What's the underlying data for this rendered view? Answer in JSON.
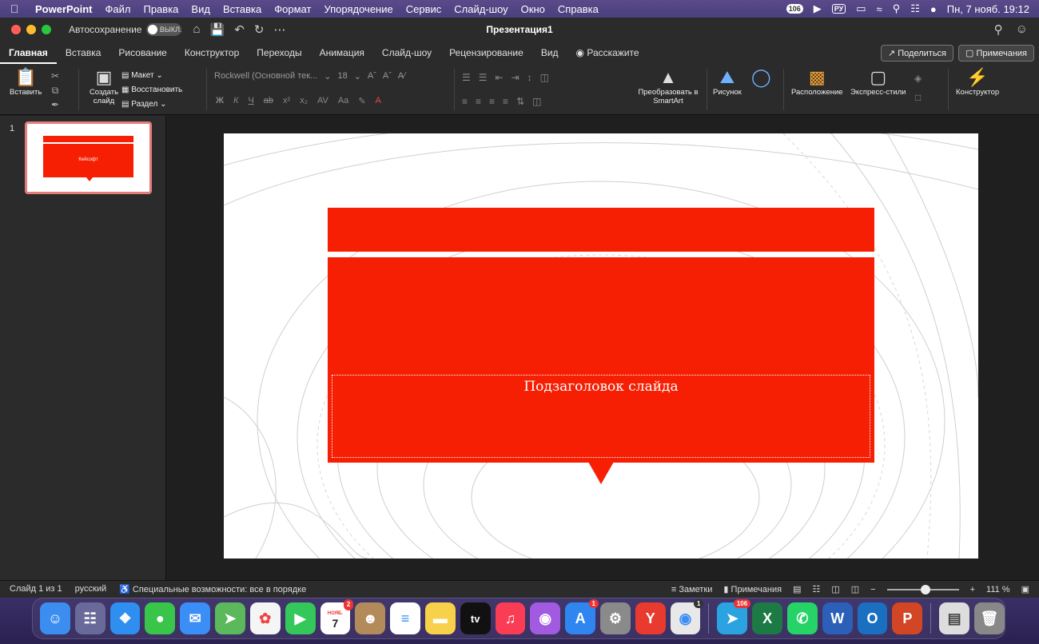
{
  "menubar": {
    "app": "PowerPoint",
    "items": [
      "Файл",
      "Правка",
      "Вид",
      "Вставка",
      "Формат",
      "Упорядочение",
      "Сервис",
      "Слайд-шоу",
      "Окно",
      "Справка"
    ],
    "badge": "106",
    "lang": "РУ",
    "datetime": "Пн, 7 нояб. 19:12"
  },
  "titlebar": {
    "autosave_label": "Автосохранение",
    "autosave_state": "ВЫКЛ.",
    "doc_title": "Презентация1"
  },
  "tabs": {
    "items": [
      "Главная",
      "Вставка",
      "Рисование",
      "Конструктор",
      "Переходы",
      "Анимация",
      "Слайд-шоу",
      "Рецензирование",
      "Вид"
    ],
    "tell_me": "Расскажите",
    "share": "Поделиться",
    "comments": "Примечания"
  },
  "ribbon": {
    "paste": "Вставить",
    "new_slide": "Создать слайд",
    "layout": "Макет",
    "reset": "Восстановить",
    "section": "Раздел",
    "font_name": "Rockwell (Основной тек...",
    "font_size": "18",
    "smartart": "Преобразовать в SmartArt",
    "picture": "Рисунок",
    "arrange": "Расположение",
    "quick_styles": "Экспресс-стили",
    "designer": "Конструктор"
  },
  "slides": {
    "number": "1",
    "thumb_title": "Кейсофт"
  },
  "slide": {
    "subtitle": "Подзаголовок слайда",
    "accent_color": "#f61f04"
  },
  "statusbar": {
    "slide_info": "Слайд 1 из 1",
    "language": "русский",
    "accessibility": "Специальные возможности: все в порядке",
    "notes": "Заметки",
    "comments": "Примечания",
    "zoom": "111 %",
    "zoom_level": 0.55
  },
  "dock": {
    "calendar_month": "НОЯБ.",
    "calendar_day": "7",
    "calendar_badge": "2",
    "appstore_badge": "1",
    "chrome_badge": "1",
    "telegram_badge": "106"
  }
}
